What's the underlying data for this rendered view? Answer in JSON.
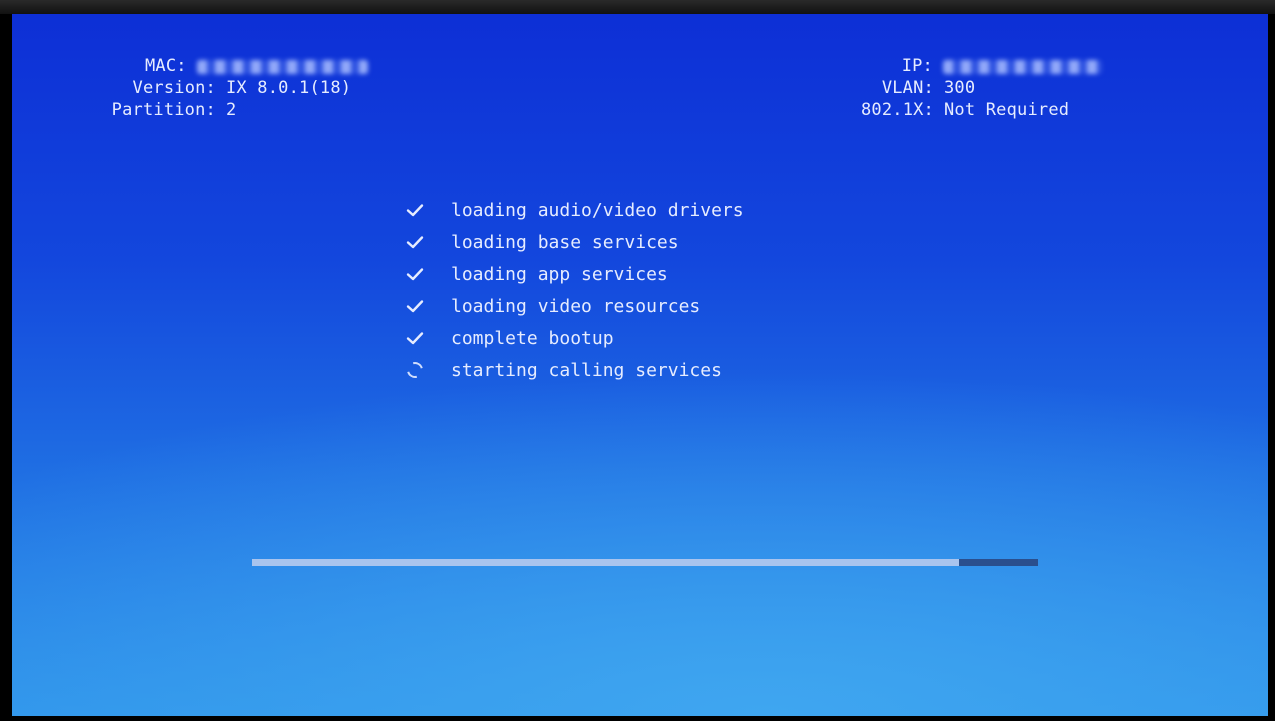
{
  "device_info": {
    "left": [
      {
        "label": "MAC:",
        "value": "",
        "redacted": true
      },
      {
        "label": "Version:",
        "value": "IX 8.0.1(18)",
        "redacted": false
      },
      {
        "label": "Partition:",
        "value": "2",
        "redacted": false
      }
    ],
    "right": [
      {
        "label": "IP:",
        "value": "",
        "redacted": true
      },
      {
        "label": "VLAN:",
        "value": "300",
        "redacted": false
      },
      {
        "label": "802.1X:",
        "value": "Not Required",
        "redacted": false
      }
    ]
  },
  "boot_steps": [
    {
      "label": "loading audio/video drivers",
      "status": "done",
      "icon": "check-icon"
    },
    {
      "label": "loading base services",
      "status": "done",
      "icon": "check-icon"
    },
    {
      "label": "loading app services",
      "status": "done",
      "icon": "check-icon"
    },
    {
      "label": "loading video resources",
      "status": "done",
      "icon": "check-icon"
    },
    {
      "label": "complete bootup",
      "status": "done",
      "icon": "check-icon"
    },
    {
      "label": "starting calling services",
      "status": "in-progress",
      "icon": "spinner-icon"
    }
  ],
  "progress": {
    "fraction": 0.9
  },
  "colors": {
    "text": "#e6ecff",
    "progress_fill": "#a9c4ee",
    "progress_track": "#2a4f8e"
  }
}
